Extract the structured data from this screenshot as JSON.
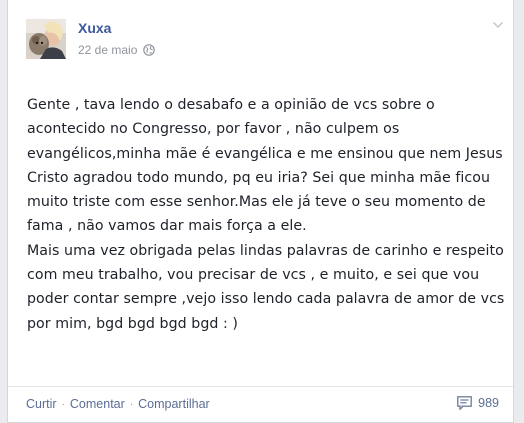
{
  "post": {
    "author": "Xuxa",
    "date": "22 de maio",
    "privacy_icon": "globe-icon",
    "paragraph_1": "Gente , tava lendo o desabafo e a opinião de vcs sobre o acontecido no Congresso, por favor , não culpem os evangélicos,minha mãe é evangélica e me ensinou que nem Jesus Cristo agradou todo mundo, pq eu iria? Sei que minha mãe ficou muito triste com esse senhor.Mas ele já teve o seu momento de fama , não vamos dar mais força a ele.",
    "paragraph_2": "Mais uma vez obrigada pelas lindas palavras de carinho e respeito com meu trabalho, vou precisar de vcs , e muito, e sei que vou poder contar sempre ,vejo isso lendo cada palavra de amor de vcs por mim, bgd bgd bgd bgd : )"
  },
  "actions": {
    "like": "Curtir",
    "comment": "Comentar",
    "share": "Compartilhar",
    "separator": "·"
  },
  "comments": {
    "icon": "comment-icon",
    "count": "989"
  },
  "colors": {
    "link": "#3b5998",
    "action": "#5b6d94",
    "meta": "#90949c",
    "text": "#1d2129"
  }
}
